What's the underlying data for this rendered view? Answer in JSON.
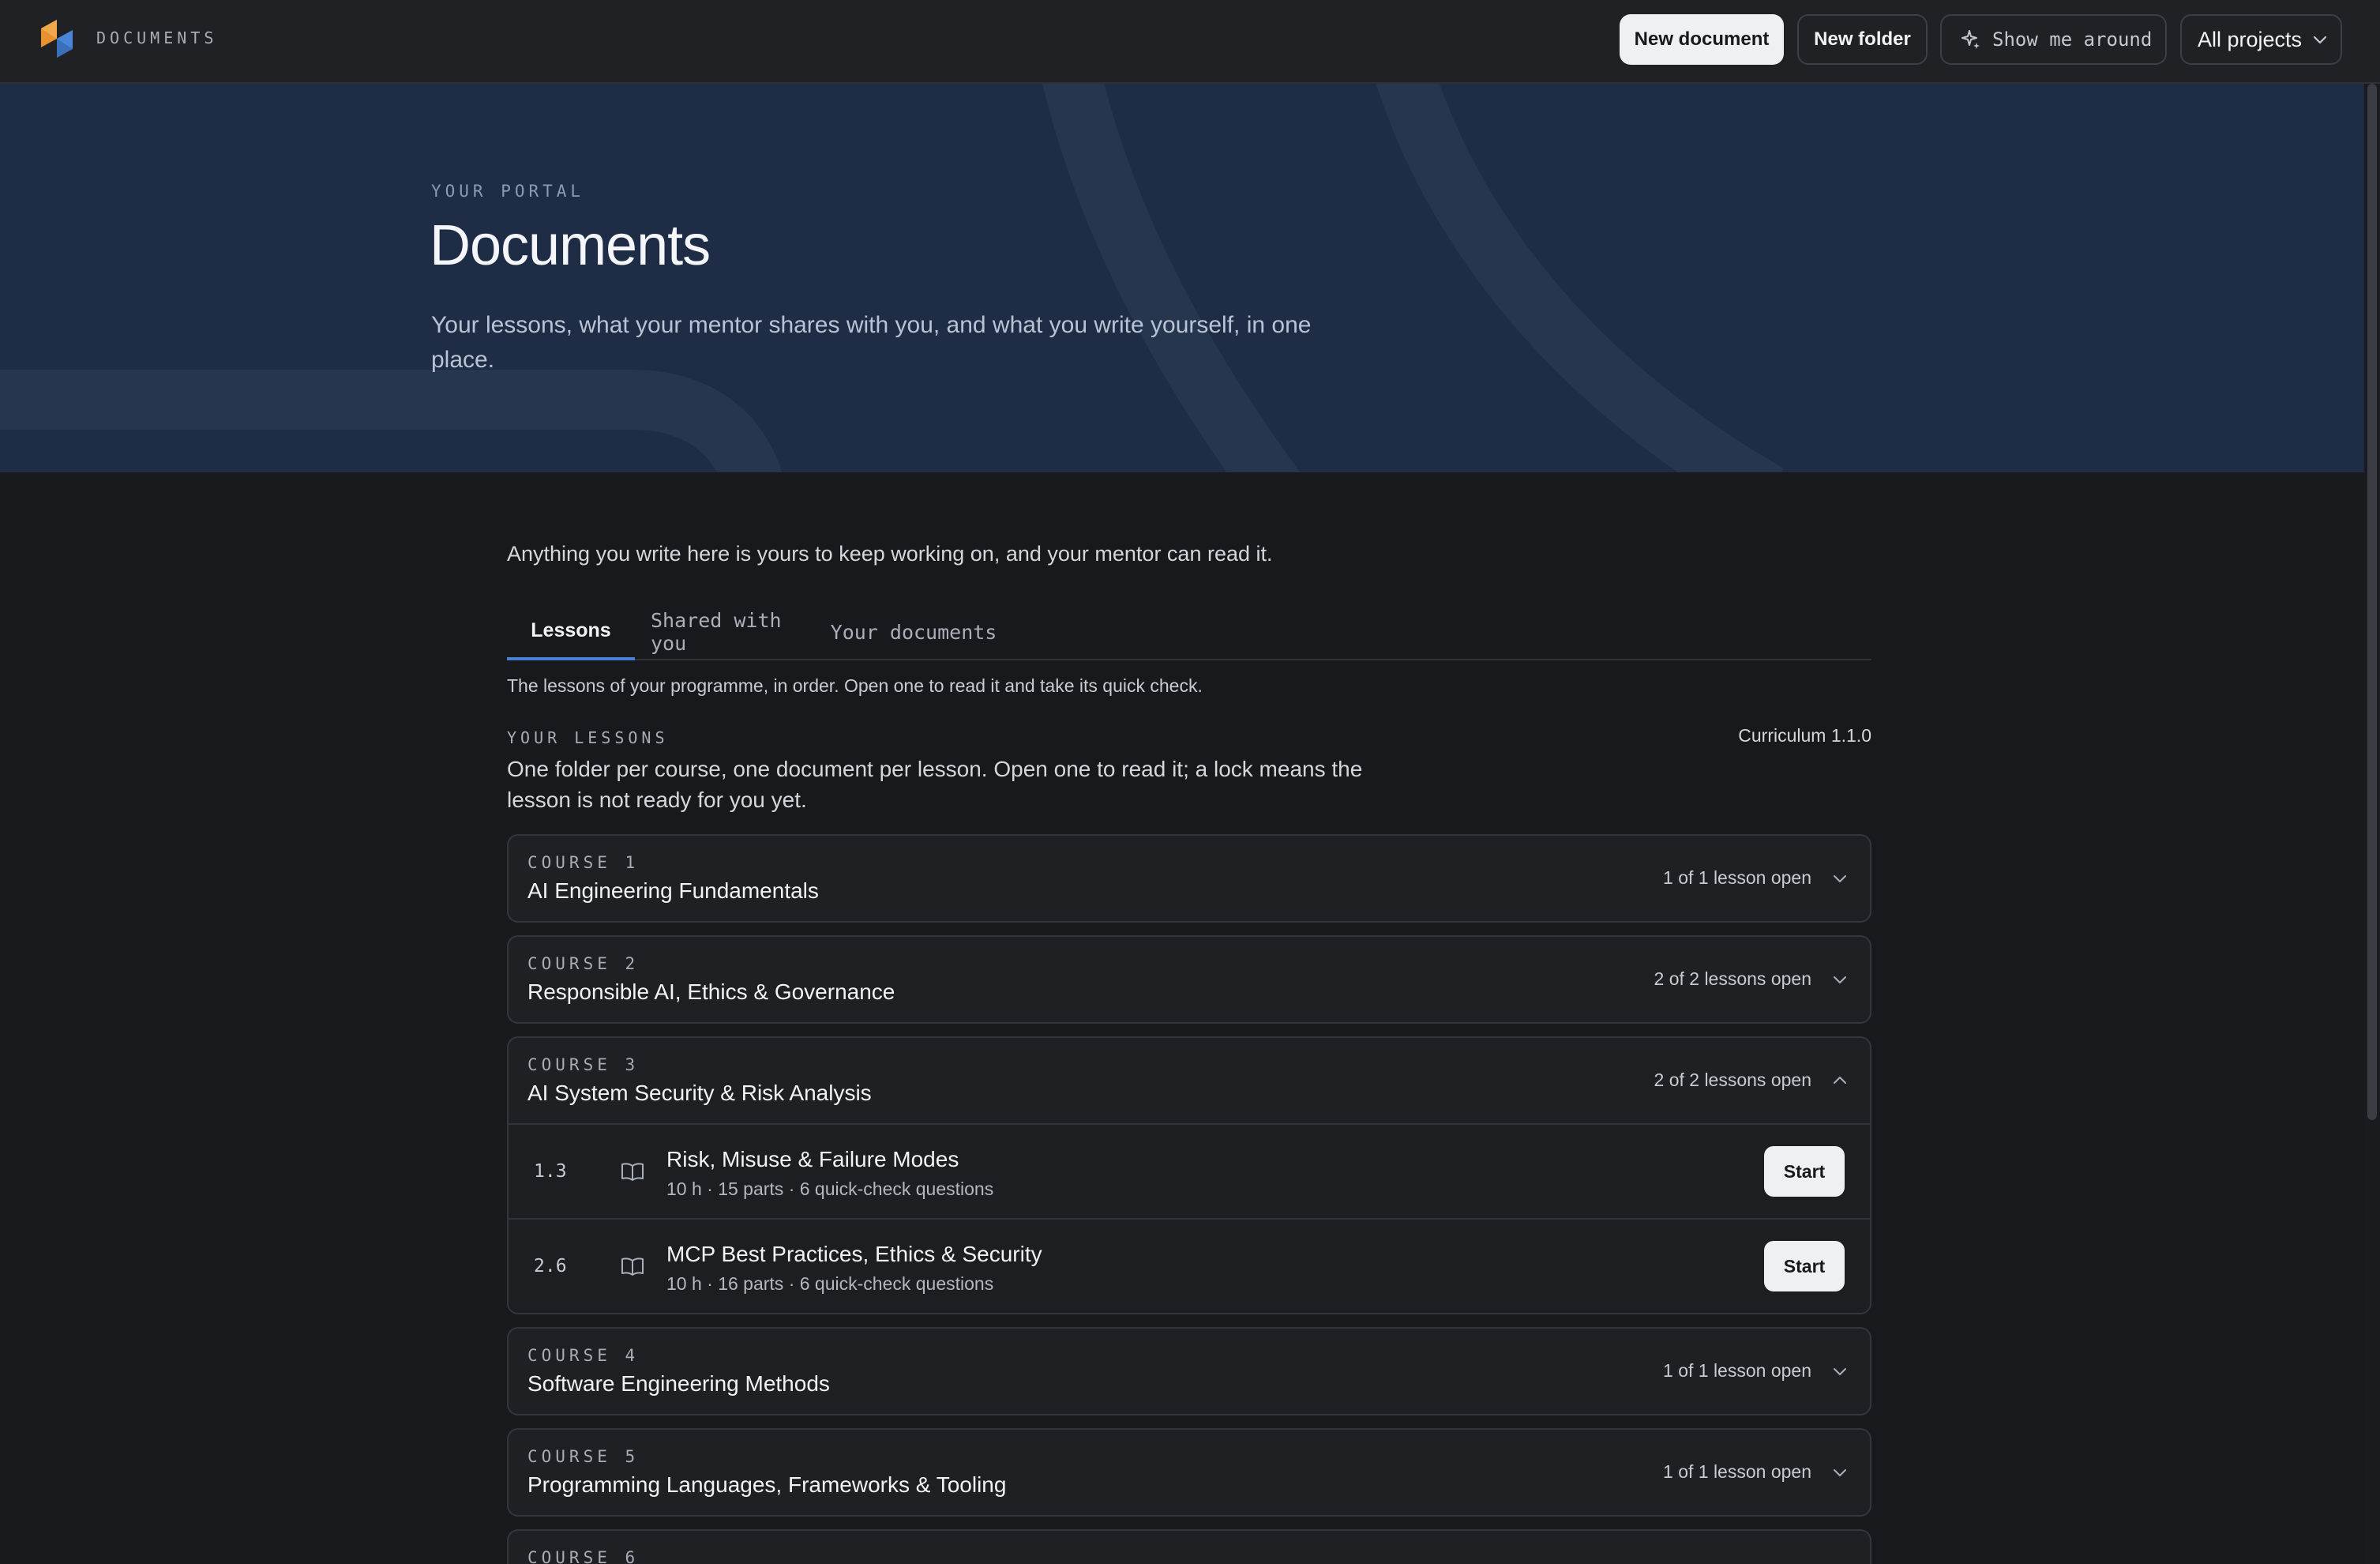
{
  "header": {
    "brand": "DOCUMENTS",
    "buttons": {
      "new_document": "New document",
      "new_folder": "New folder",
      "show_around": "Show me around",
      "projects": "All projects"
    }
  },
  "hero": {
    "eyebrow": "YOUR PORTAL",
    "title": "Documents",
    "subtitle": "Your lessons, what your mentor shares with you, and what you write yourself, in one place."
  },
  "intro": "Anything you write here is yours to keep working on, and your mentor can read it.",
  "tabs": [
    {
      "label": "Lessons",
      "active": true
    },
    {
      "label": "Shared with you",
      "active": false
    },
    {
      "label": "Your documents",
      "active": false
    }
  ],
  "tab_description": "The lessons of your programme, in order. Open one to read it and take its quick check.",
  "lessons_section": {
    "eyebrow": "YOUR LESSONS",
    "description": "One folder per course, one document per lesson. Open one to read it; a lock means the lesson is not ready for you yet.",
    "curriculum": "Curriculum 1.1.0"
  },
  "courses": [
    {
      "number": "COURSE 1",
      "title": "AI Engineering Fundamentals",
      "count": "1 of 1 lesson open",
      "expanded": false
    },
    {
      "number": "COURSE 2",
      "title": "Responsible AI, Ethics & Governance",
      "count": "2 of 2 lessons open",
      "expanded": false
    },
    {
      "number": "COURSE 3",
      "title": "AI System Security & Risk Analysis",
      "count": "2 of 2 lessons open",
      "expanded": true,
      "lessons": [
        {
          "id": "1.3",
          "title": "Risk, Misuse & Failure Modes",
          "meta": "10 h · 15 parts · 6 quick-check questions",
          "action": "Start",
          "icon": "book-icon"
        },
        {
          "id": "2.6",
          "title": "MCP Best Practices, Ethics & Security",
          "meta": "10 h · 16 parts · 6 quick-check questions",
          "action": "Start",
          "icon": "book-icon"
        }
      ]
    },
    {
      "number": "COURSE 4",
      "title": "Software Engineering Methods",
      "count": "1 of 1 lesson open",
      "expanded": false
    },
    {
      "number": "COURSE 5",
      "title": "Programming Languages, Frameworks & Tooling",
      "count": "1 of 1 lesson open",
      "expanded": false
    },
    {
      "number": "COURSE 6",
      "title": "",
      "count": "",
      "expanded": false
    }
  ],
  "colors": {
    "page_bg": "#17191d",
    "topbar_bg": "#1f2125",
    "hero_bg": "#1e2c45",
    "accent": "#4a7fd6",
    "logo_orange": "#e8912f",
    "logo_blue": "#4a86d8"
  }
}
